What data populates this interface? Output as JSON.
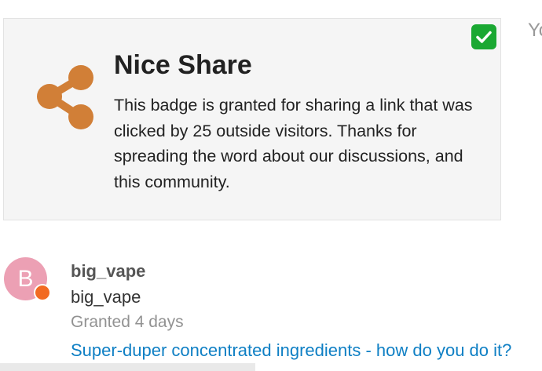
{
  "badge": {
    "title": "Nice Share",
    "description": "This badge is granted for sharing a link that was clicked by 25 outside visitors. Thanks for spreading the word about our discussions, and this community.",
    "icon": "share-icon",
    "icon_color": "#d17f37",
    "granted_indicator": "checkmark-icon",
    "granted_color": "#1aa832"
  },
  "side_text": "Yo",
  "grant": {
    "avatar_letter": "B",
    "avatar_color": "#eca0b4",
    "status_color": "#f26a22",
    "username": "big_vape",
    "name": "big_vape",
    "granted_text": "Granted 4 days",
    "post_title": "Super-duper concentrated ingredients - how do you do it?"
  }
}
